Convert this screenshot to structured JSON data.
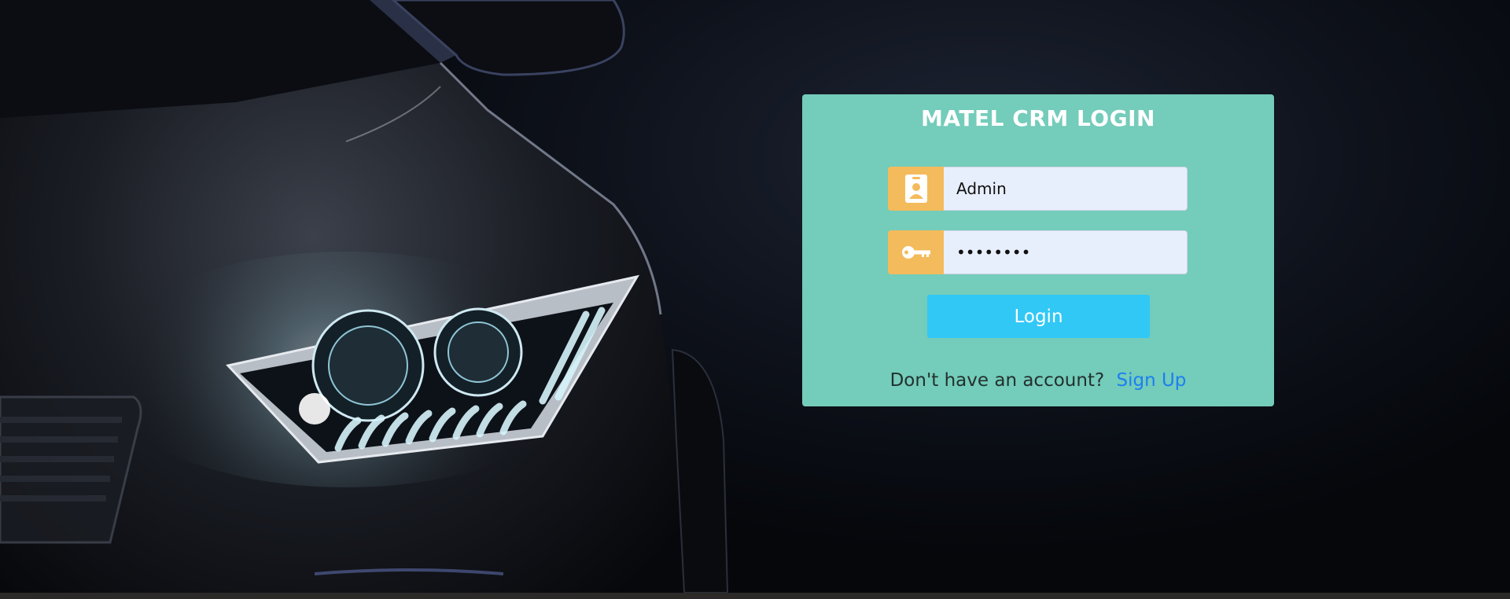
{
  "login": {
    "title": "MATEL CRM LOGIN",
    "username_value": "Admin",
    "password_value": "password",
    "login_label": "Login",
    "signup_prompt": "Don't have an account?",
    "signup_link": "Sign Up"
  },
  "icons": {
    "username": "id-badge-icon",
    "password": "key-icon"
  },
  "colors": {
    "card": "#74ccba",
    "addon": "#f4bb5c",
    "button": "#31c8f6",
    "link": "#1c7ff0"
  }
}
